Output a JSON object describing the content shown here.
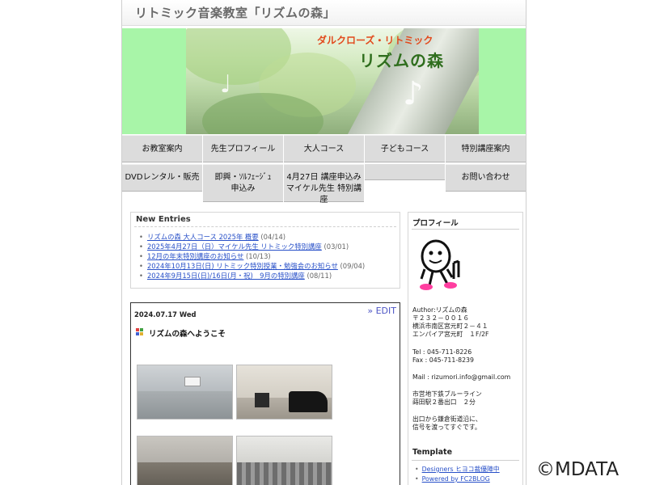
{
  "site": {
    "title": "リトミック音楽教室「リズムの森」"
  },
  "banner": {
    "subtitle": "ダルクローズ・リトミック",
    "name": "リズムの森"
  },
  "nav": {
    "row1": [
      "お教室案内",
      "先生プロフィール",
      "大人コース",
      "子どもコース",
      "特別講座案内"
    ],
    "dvd": "DVDレンタル・販売",
    "improv": [
      "即興・ｿﾙﾌｪｰｼﾞｭ",
      "申込み"
    ],
    "special": [
      "4月27日 講座申込み",
      "マイケル先生 特別講座"
    ],
    "contact": "お問い合わせ"
  },
  "entries": {
    "title": "New Entries",
    "items": [
      {
        "link": "リズムの森 大人コース 2025年 概要",
        "date": "(04/14)"
      },
      {
        "link": "2025年4月27日（日）マイケル先生 リトミック特別講座",
        "date": "(03/01)"
      },
      {
        "link": "12月の年末特別講座のお知らせ",
        "date": "(10/13)"
      },
      {
        "link": "2024年10月13日(日) リトミック特別授業・勉強会のお知らせ",
        "date": "(09/04)"
      },
      {
        "link": "2024年9月15日(日)/16日(月・祝)　9月の特別講座",
        "date": "(08/11)"
      }
    ]
  },
  "post": {
    "date": "2024.07.17 Wed",
    "edit": "» EDIT",
    "title": "リズムの森へようこそ"
  },
  "profile": {
    "title": "プロフィール",
    "address": "Author:リズムの森\n〒２３２－００１６\n横浜市南区宮元町２－４１\nエンパイア宮元町　１F/2F",
    "phone": "Tel : 045-711-8226\nFax : 045-711-8239",
    "mail": "Mail : rizumori.info@gmail.com",
    "access": "市営地下鉄ブルーライン\n蒔田駅２番出口　２分",
    "directions": "出口から鎌倉街道沿に、\n信号を渡ってすぐです。"
  },
  "template": {
    "title": "Template",
    "items": [
      "Designers ヒヨコ裁優陣中",
      "Powered by FC2BLOG"
    ]
  },
  "watermark": "©MDATA",
  "colors": {
    "banner_green": "#a8f5a8",
    "link": "#2850c8",
    "nav_gray": "#dcdcdc",
    "edit": "#4d55c5",
    "accent_red": "#e24a1d"
  }
}
